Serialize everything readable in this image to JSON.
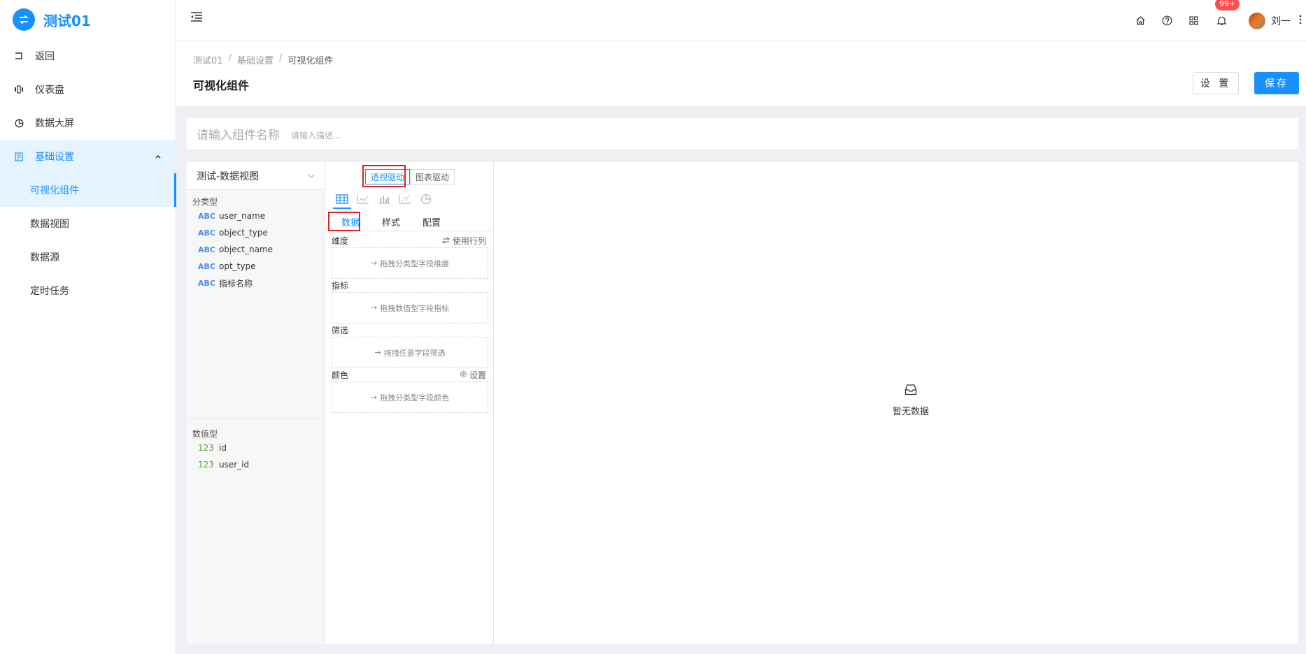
{
  "app": {
    "title": "测试01"
  },
  "sidebar": {
    "items": [
      {
        "label": "返回",
        "icon": "back-icon"
      },
      {
        "label": "仪表盘",
        "icon": "dashboard-icon"
      },
      {
        "label": "数据大屏",
        "icon": "pie-icon"
      },
      {
        "label": "基础设置",
        "icon": "settings-grid-icon",
        "expanded": true
      }
    ],
    "subitems": [
      {
        "label": "可视化组件",
        "active": true
      },
      {
        "label": "数据视图"
      },
      {
        "label": "数据源"
      },
      {
        "label": "定时任务"
      }
    ]
  },
  "header": {
    "badge": "99+",
    "user_name": "刘一"
  },
  "page": {
    "breadcrumb": [
      "测试01",
      "基础设置",
      "可视化组件"
    ],
    "title": "可视化组件",
    "settings_label": "设 置",
    "save_label": "保存"
  },
  "component": {
    "name_placeholder": "请输入组件名称",
    "desc_placeholder": "请输入描述..."
  },
  "fields": {
    "dataset": "测试-数据视图",
    "category_title": "分类型",
    "category_fields": [
      {
        "type": "ABC",
        "name": "user_name"
      },
      {
        "type": "ABC",
        "name": "object_type"
      },
      {
        "type": "ABC",
        "name": "object_name"
      },
      {
        "type": "ABC",
        "name": "opt_type"
      },
      {
        "type": "ABC",
        "name": "指标名称"
      }
    ],
    "numeric_title": "数值型",
    "numeric_fields": [
      {
        "type": "123",
        "name": "id"
      },
      {
        "type": "123",
        "name": "user_id"
      }
    ]
  },
  "config": {
    "mode_tabs": [
      "透视驱动",
      "图表驱动"
    ],
    "tabs": [
      "数据",
      "样式",
      "配置"
    ],
    "dimension_label": "维度",
    "use_row_col": "使用行列",
    "dimension_drop": "拖拽分类型字段维度",
    "metric_label": "指标",
    "metric_drop": "拖拽数值型字段指标",
    "filter_label": "筛选",
    "filter_drop": "拖拽任意字段筛选",
    "color_label": "颜色",
    "color_settings": "设置",
    "color_drop": "拖拽分类型字段颜色"
  },
  "chart": {
    "empty_text": "暂无数据"
  },
  "colors": {
    "primary": "#1890ff",
    "highlight": "#e02020",
    "badge": "#ff4d4f"
  }
}
